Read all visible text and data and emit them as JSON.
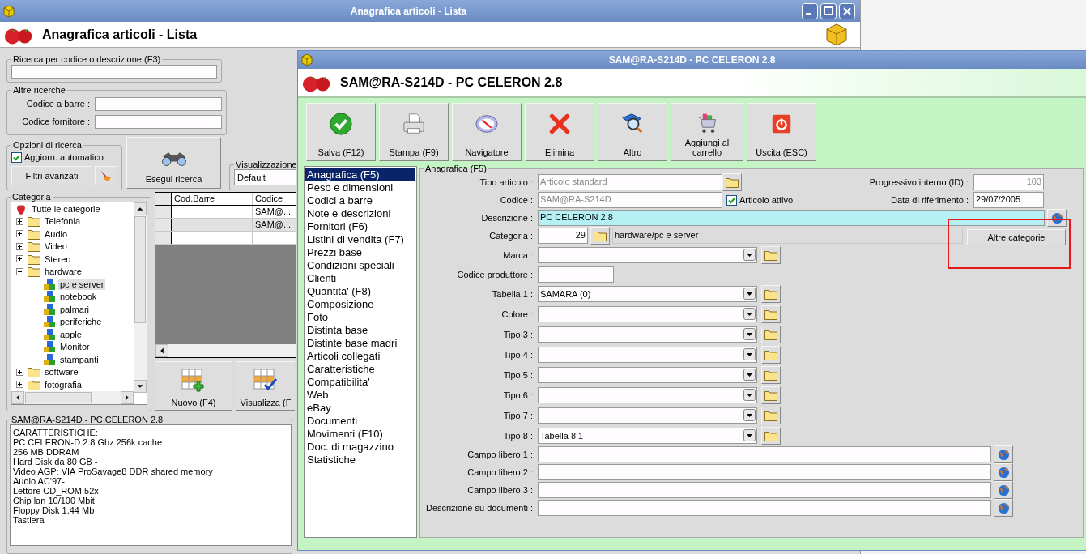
{
  "back_window": {
    "title": "Anagrafica articoli  - Lista",
    "header": "Anagrafica articoli  - Lista",
    "quick_search": {
      "legend": "Ricerca per codice o descrizione (F3)"
    },
    "other_searches": {
      "legend": "Altre ricerche",
      "fields": [
        {
          "label": "Codice a barre :"
        },
        {
          "label": "Codice fornitore :"
        }
      ]
    },
    "search_options": {
      "legend": "Opzioni di ricerca",
      "auto_update": {
        "label": "Aggiorn. automatico",
        "checked": true
      },
      "filters_button": "Filtri avanzati"
    },
    "search_button": "Esegui ricerca",
    "view": {
      "legend": "Visualizzazione",
      "value": "Default"
    },
    "category": {
      "legend": "Categoria",
      "tree": [
        {
          "label": "Tutte le categorie",
          "kind": "root",
          "selected": false,
          "children": [
            {
              "label": "Telefonia",
              "kind": "folder",
              "expanded": false,
              "selected": false
            },
            {
              "label": "Audio",
              "kind": "folder",
              "expanded": false,
              "selected": false
            },
            {
              "label": "Video",
              "kind": "folder",
              "expanded": false,
              "selected": false
            },
            {
              "label": "Stereo",
              "kind": "folder",
              "expanded": false,
              "selected": false
            },
            {
              "label": "hardware",
              "kind": "folder",
              "expanded": true,
              "selected": false,
              "children": [
                {
                  "label": "pc e server",
                  "kind": "category",
                  "selected": true
                },
                {
                  "label": "notebook",
                  "kind": "category",
                  "selected": false
                },
                {
                  "label": "palmari",
                  "kind": "category",
                  "selected": false
                },
                {
                  "label": "periferiche",
                  "kind": "category",
                  "selected": false
                },
                {
                  "label": "apple",
                  "kind": "category",
                  "selected": false
                },
                {
                  "label": "Monitor",
                  "kind": "category",
                  "selected": false
                },
                {
                  "label": "stampanti",
                  "kind": "category",
                  "selected": false
                }
              ]
            },
            {
              "label": "software",
              "kind": "folder",
              "expanded": false,
              "selected": false
            },
            {
              "label": "fotografia",
              "kind": "folder",
              "expanded": false,
              "selected": false
            }
          ]
        }
      ]
    },
    "grid": {
      "columns": [
        "Cod.Barre",
        "Codice"
      ],
      "rows": [
        {
          "cells": [
            null,
            "SAM@..."
          ],
          "selected": false
        },
        {
          "cells": [
            null,
            "SAM@..."
          ],
          "selected": true
        }
      ]
    },
    "grid_buttons": [
      {
        "label": "Nuovo (F4)",
        "kind": "new"
      },
      {
        "label": "Visualizza (F",
        "kind": "view"
      }
    ],
    "notes": {
      "legend": "SAM@RA-S214D - PC CELERON 2.8",
      "lines": [
        "CARATTERISTICHE:",
        "PC CELERON-D 2.8 Ghz 256k cache",
        "256 MB DDRAM",
        "Hard Disk da 80 GB -",
        "Video AGP: VIA ProSavage8 DDR shared memory",
        "Audio AC'97-",
        "Lettore CD_ROM 52x",
        "Chip lan 10/100 Mbit",
        "Floppy Disk 1.44 Mb",
        "Tastiera"
      ]
    }
  },
  "item_window": {
    "title": "SAM@RA-S214D - PC CELERON 2.8",
    "header": "SAM@RA-S214D - PC CELERON 2.8",
    "toolbar": [
      {
        "label": "Salva (F12)",
        "kind": "save"
      },
      {
        "label": "Stampa (F9)",
        "kind": "print"
      },
      {
        "label": "Navigatore",
        "kind": "navigator"
      },
      {
        "label": "Elimina",
        "kind": "delete"
      },
      {
        "label": "Altro",
        "kind": "other"
      },
      {
        "label": "Aggiungi al carrello",
        "kind": "cart"
      },
      {
        "label": "Uscita (ESC)",
        "kind": "exit"
      }
    ],
    "sections": [
      {
        "label": "Anagrafica (F5)",
        "selected": true
      },
      {
        "label": "Peso e dimensioni",
        "selected": false
      },
      {
        "label": "Codici a barre",
        "selected": false
      },
      {
        "label": "Note e descrizioni",
        "selected": false
      },
      {
        "label": "Fornitori (F6)",
        "selected": false
      },
      {
        "label": "Listini di vendita (F7)",
        "selected": false
      },
      {
        "label": "Prezzi base",
        "selected": false
      },
      {
        "label": "Condizioni speciali",
        "selected": false
      },
      {
        "label": "Clienti",
        "selected": false
      },
      {
        "label": "Quantita' (F8)",
        "selected": false
      },
      {
        "label": "Composizione",
        "selected": false
      },
      {
        "label": "Foto",
        "selected": false
      },
      {
        "label": "Distinta base",
        "selected": false
      },
      {
        "label": "Distinte base madri",
        "selected": false
      },
      {
        "label": "Articoli collegati",
        "selected": false
      },
      {
        "label": "Caratteristiche",
        "selected": false
      },
      {
        "label": "Compatibilita'",
        "selected": false
      },
      {
        "label": "Web",
        "selected": false
      },
      {
        "label": "eBay",
        "selected": false
      },
      {
        "label": "Documenti",
        "selected": false
      },
      {
        "label": "Movimenti (F10)",
        "selected": false
      },
      {
        "label": "Doc. di magazzino",
        "selected": false
      },
      {
        "label": "Statistiche",
        "selected": false
      }
    ],
    "form": {
      "legend": "Anagrafica (F5)",
      "tipo_articolo": {
        "label": "Tipo articolo :",
        "value": "Articolo standard",
        "disabled": true
      },
      "codice": {
        "label": "Codice :",
        "value": "SAM@RA-S214D",
        "disabled": true
      },
      "articolo_attivo": {
        "label": "Articolo attivo",
        "checked": true
      },
      "progressivo": {
        "label": "Progressivo interno (ID) :",
        "value": "103",
        "disabled": true
      },
      "data_riferimento": {
        "label": "Data di riferimento :",
        "value": "29/07/2005",
        "disabled": false
      },
      "descrizione": {
        "label": "Descrizione :",
        "value": "PC CELERON 2.8",
        "focused": true
      },
      "categoria": {
        "label": "Categoria :",
        "code": "29",
        "path": "hardware/pc e server"
      },
      "altre_categorie_button": "Altre categorie",
      "rows": [
        {
          "kind": "combo",
          "label": "Marca :"
        },
        {
          "kind": "text",
          "label": "Codice produttore :"
        },
        {
          "kind": "combo",
          "label": "Tabella 1 :",
          "value": "SAMARA (0)"
        },
        {
          "kind": "combo",
          "label": "Colore :"
        },
        {
          "kind": "combo",
          "label": "Tipo 3 :"
        },
        {
          "kind": "combo",
          "label": "Tipo 4 :"
        },
        {
          "kind": "combo",
          "label": "Tipo 5 :"
        },
        {
          "kind": "combo",
          "label": "Tipo 6 :"
        },
        {
          "kind": "combo",
          "label": "Tipo 7 :"
        },
        {
          "kind": "combo",
          "label": "Tipo 8 :",
          "value": "Tabella 8 1"
        },
        {
          "kind": "free",
          "label": "Campo libero 1 :"
        },
        {
          "kind": "free",
          "label": "Campo libero 2 :"
        },
        {
          "kind": "free",
          "label": "Campo libero 3 :"
        },
        {
          "kind": "free",
          "label": "Descrizione su documenti :"
        }
      ]
    },
    "annotation": {
      "kind": "rectangle"
    }
  }
}
